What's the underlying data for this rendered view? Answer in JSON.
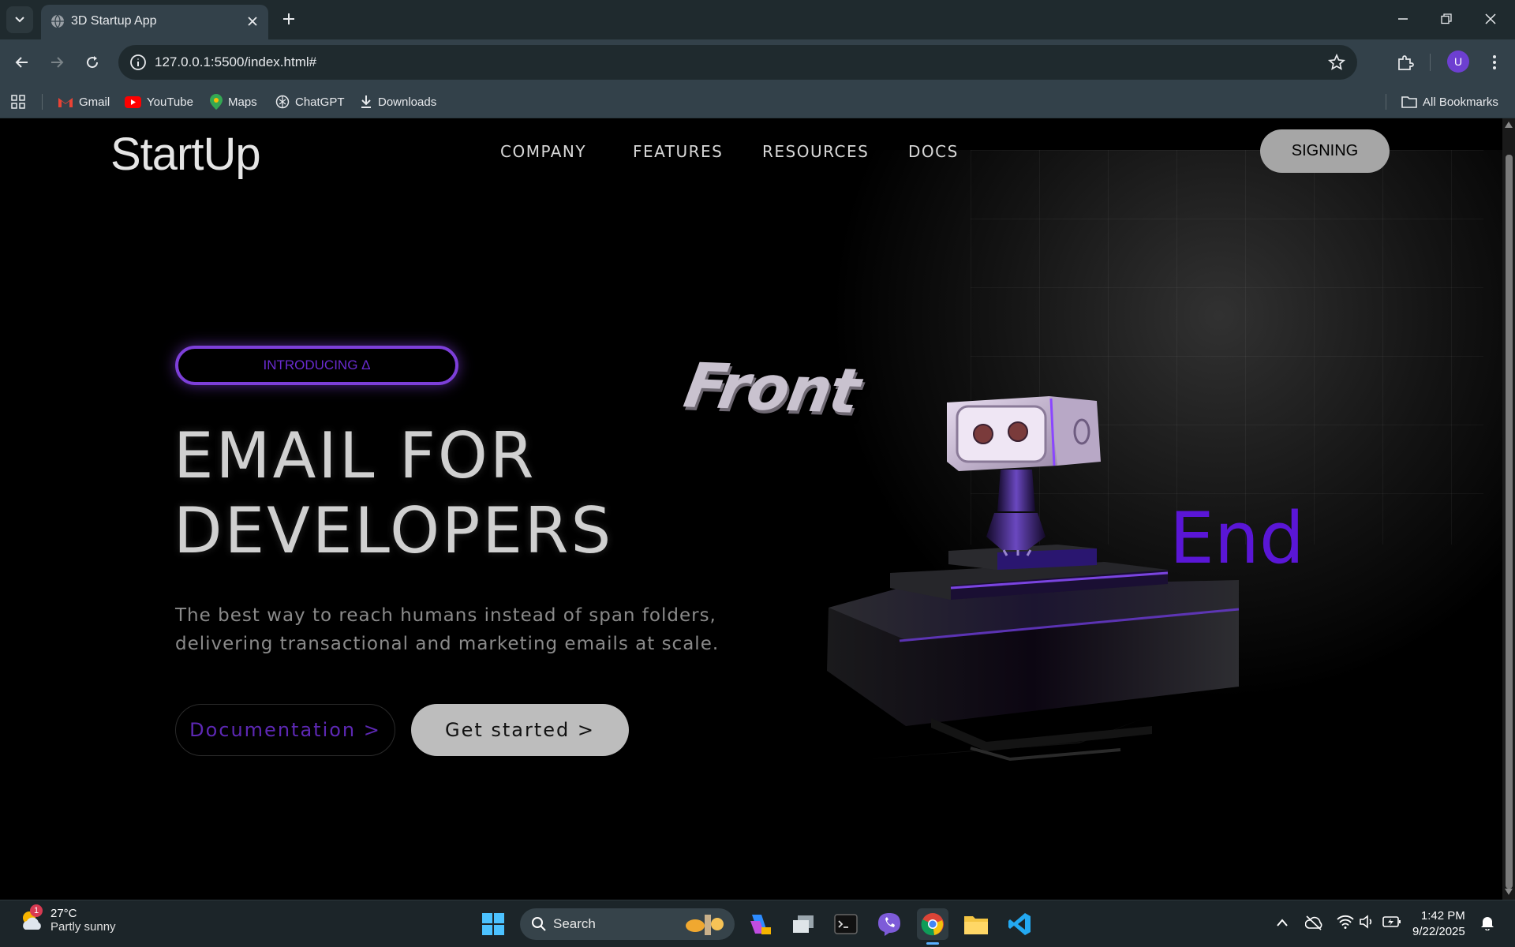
{
  "browser": {
    "tab_title": "3D Startup App",
    "url": "127.0.0.1:5500/index.html#",
    "profile_initial": "U",
    "bookmarks": [
      {
        "label": "Gmail",
        "icon": "gmail-icon"
      },
      {
        "label": "YouTube",
        "icon": "youtube-icon"
      },
      {
        "label": "Maps",
        "icon": "maps-icon"
      },
      {
        "label": "ChatGPT",
        "icon": "chatgpt-icon"
      },
      {
        "label": "Downloads",
        "icon": "download-icon"
      }
    ],
    "all_bookmarks": "All Bookmarks"
  },
  "site": {
    "logo": "StartUp",
    "nav": [
      "COMPANY",
      "FEATURES",
      "RESOURCES",
      "DOCS"
    ],
    "signing": "SIGNING",
    "intro": "INTRODUCING Δ",
    "headline_1": "EMAIL FOR",
    "headline_2": "DEVELOPERS",
    "sub_1": "The best way to reach humans instead of span folders,",
    "sub_2": "delivering transactional and marketing emails at scale.",
    "btn_docs": "Documentation >",
    "btn_start": "Get started >",
    "scene_front": "Front",
    "scene_end": "End",
    "accent": "#6a2bd0"
  },
  "taskbar": {
    "weather_badge": "1",
    "weather_temp": "27°C",
    "weather_desc": "Partly sunny",
    "search": "Search",
    "time": "1:42 PM",
    "date": "9/22/2025"
  }
}
